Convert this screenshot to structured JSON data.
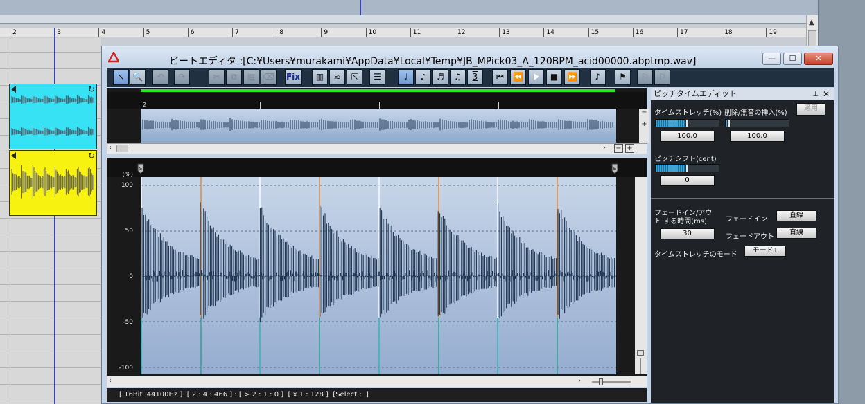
{
  "host": {
    "ruler_marks": [
      "2",
      "3",
      "4",
      "5",
      "6",
      "7",
      "8",
      "9",
      "10",
      "11",
      "12",
      "13",
      "14",
      "15",
      "16",
      "17",
      "18",
      "19"
    ],
    "scroll_up": "▲"
  },
  "window": {
    "title": "ビートエディタ  :[C:¥Users¥murakami¥AppData¥Local¥Temp¥JB_MPick03_A_120BPM_acid00000.abptmp.wav]",
    "minimize": "—",
    "maximize": "☐",
    "close": "✕"
  },
  "toolbar": {
    "fix_label": "Fix",
    "note_triplet_label": "3",
    "icons": [
      "cursor-icon",
      "zoom-icon",
      "undo-icon",
      "redo-icon",
      "cut-icon",
      "copy-icon",
      "paste-icon",
      "eraser-icon",
      "fix-icon",
      "view-bar-icon",
      "view-wave-icon",
      "cursor-time-icon",
      "marker-icon",
      "quarter-note-icon",
      "eighth-note-icon",
      "sixteenth-note-icon",
      "thirtysecond-note-icon",
      "triplet-icon",
      "rewind-start-icon",
      "rewind-icon",
      "play-icon",
      "stop-icon",
      "fast-forward-icon",
      "metronome-note-icon",
      "flag-icon",
      "flag-left-icon",
      "flag-right-icon"
    ]
  },
  "overview": {
    "position_label": "2",
    "minus": "−",
    "plus": "+"
  },
  "waveform": {
    "unit": "(%)",
    "y_ticks": [
      "100",
      "50",
      "0",
      "-50",
      "-100"
    ],
    "start_marker": "S",
    "end_marker": "E"
  },
  "status": "[ 16Bit  44100Hz ]  [ 2 : 4 : 466 ] : [ > 2 : 1 : 0 ]  [ x 1 : 128 ]  [Select :  ]",
  "panel": {
    "title": "ピッチタイムエディット",
    "pin": "📌",
    "close": "✕",
    "time_stretch_label": "タイムストレッチ(%)",
    "time_stretch_value": "100.0",
    "time_stretch_level": 0.5,
    "delete_insert_label": "削除/無音の挿入(%)",
    "delete_insert_value": "100.0",
    "delete_insert_level": 0.05,
    "apply_label": "適用",
    "pitch_shift_label": "ピッチシフト(cent)",
    "pitch_shift_value": "0",
    "pitch_shift_level": 0.5,
    "fade_time_label": "フェードイン/アウト する時間(ms)",
    "fade_time_value": "30",
    "fade_in_label": "フェードイン",
    "fade_in_value": "直線",
    "fade_out_label": "フェードアウト",
    "fade_out_value": "直線",
    "mode_label": "タイムストレッチのモード",
    "mode_value": "モード1"
  },
  "colors": {
    "clip_cyan": "#38e2f5",
    "clip_yellow": "#f7f210",
    "wave": "#1d3550",
    "beat_line_orange": "#e8862a",
    "beat_line_teal": "#1aa7b0",
    "progress_green": "#22e81e"
  }
}
